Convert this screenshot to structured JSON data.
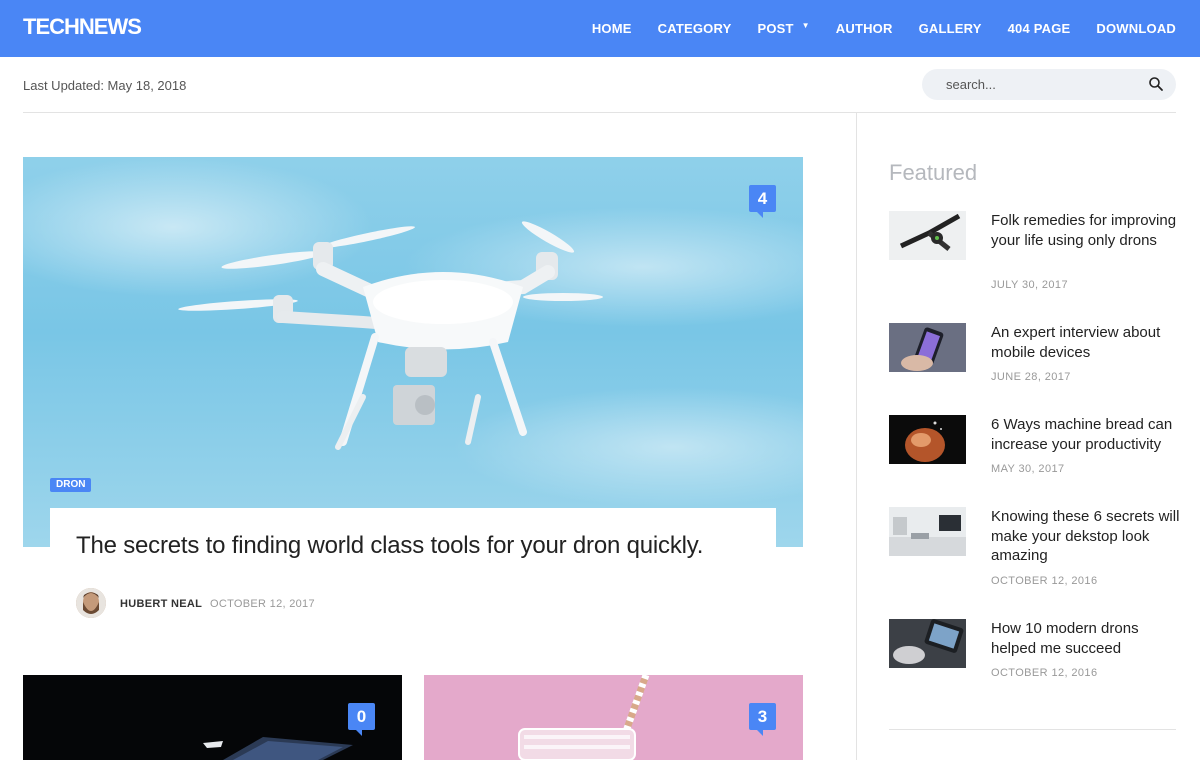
{
  "header": {
    "logo": "TECHNEWS",
    "nav": [
      "HOME",
      "CATEGORY",
      "POST",
      "AUTHOR",
      "GALLERY",
      "404 PAGE",
      "DOWNLOAD"
    ]
  },
  "subbar": {
    "last_updated": "Last Updated: May 18, 2018",
    "search_placeholder": "search..."
  },
  "hero": {
    "comment_count": "4",
    "tag": "DRON",
    "title": "The secrets to finding world class tools for your dron quickly.",
    "author": "HUBERT NEAL",
    "date": "OCTOBER 12, 2017"
  },
  "cards": [
    {
      "comment_count": "0"
    },
    {
      "comment_count": "3"
    }
  ],
  "sidebar": {
    "heading": "Featured",
    "items": [
      {
        "title": "Folk remedies for improving your life using only drons",
        "date": "JULY 30, 2017"
      },
      {
        "title": "An expert interview about mobile devices",
        "date": "JUNE 28, 2017"
      },
      {
        "title": "6 Ways machine bread can increase your productivity",
        "date": "MAY 30, 2017"
      },
      {
        "title": "Knowing these 6 secrets will make your dekstop look amazing",
        "date": "OCTOBER 12, 2016"
      },
      {
        "title": "How 10 modern drons helped me succeed",
        "date": "OCTOBER 12, 2016"
      }
    ]
  },
  "colors": {
    "accent": "#4a86f5",
    "text": "#222222",
    "muted": "#999999"
  }
}
